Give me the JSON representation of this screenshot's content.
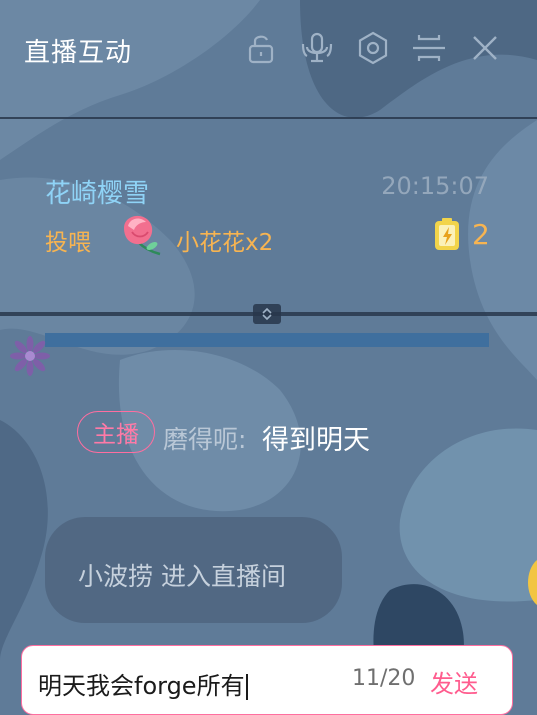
{
  "header": {
    "title": "直播互动",
    "icons": [
      "lock-icon",
      "microphone-icon",
      "settings-hexagon-icon",
      "compress-icon",
      "close-icon"
    ]
  },
  "gift": {
    "user": "花崎樱雪",
    "time": "20:15:07",
    "action": "投喂",
    "item": "小花花x2",
    "count": "2"
  },
  "chat": {
    "host_badge": "主播",
    "sender": "磨得呃:",
    "message": "得到明天"
  },
  "notice": {
    "text": "小波捞 进入直播间"
  },
  "input": {
    "value": "明天我会forge所有",
    "counter": "11/20",
    "send_label": "发送"
  },
  "colors": {
    "accent_pink": "#ff6ea0",
    "gift_orange": "#f7b451",
    "username_blue": "#8fd3f6"
  }
}
